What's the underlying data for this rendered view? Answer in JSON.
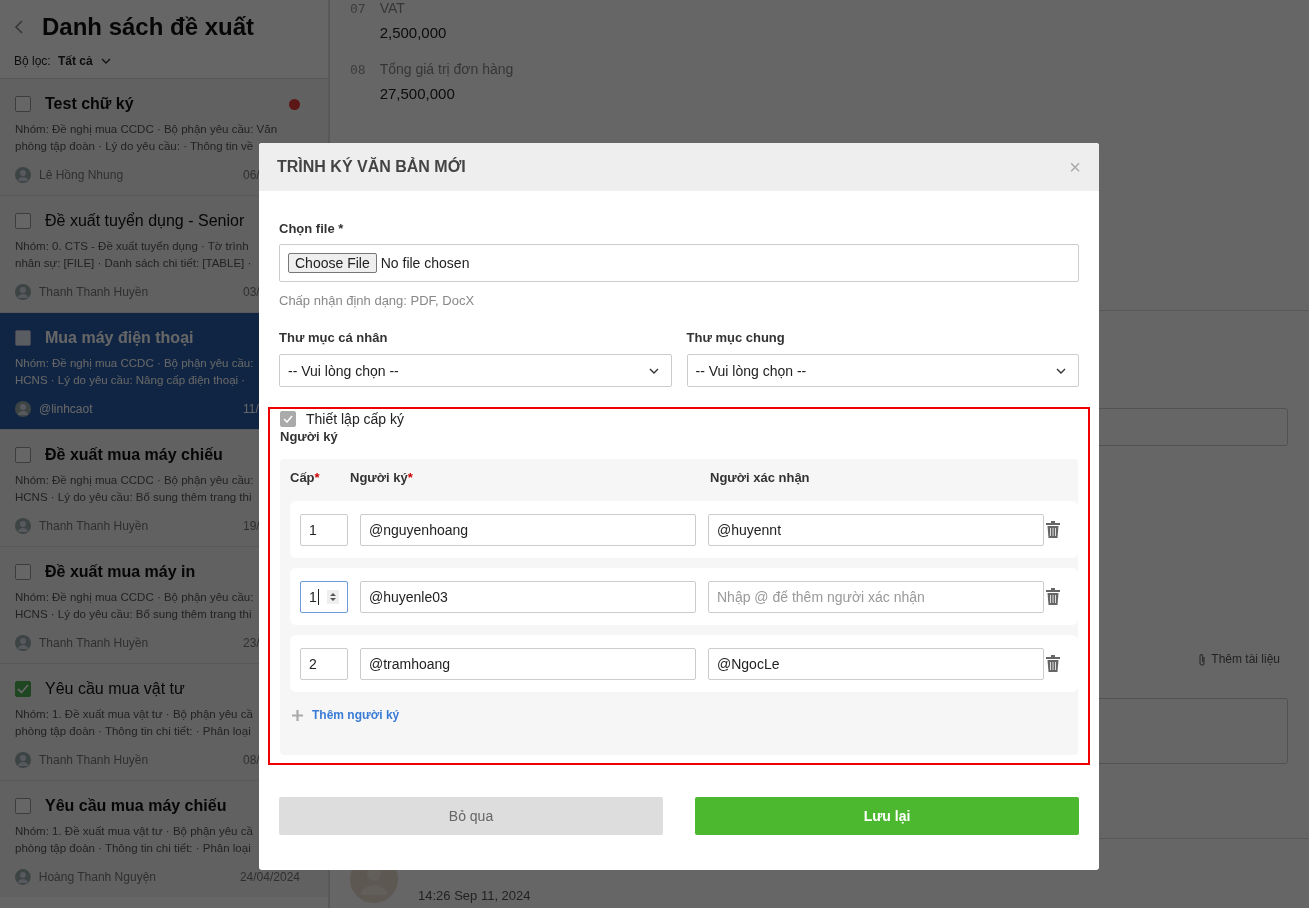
{
  "list_panel": {
    "title": "Danh sách đề xuất",
    "filter_label": "Bộ lọc:",
    "filter_value": "Tất cả",
    "items": [
      {
        "title": "Test chữ ký",
        "unread": true,
        "flagged": true,
        "checked": false,
        "selected": false,
        "description": [
          "Nhóm: Đề nghị mua CCDC · Bộ phận yêu cầu: Văn",
          "phòng tập đoàn · Lý do yêu cầu: · Thông tin về"
        ],
        "author": "Lê Hồng Nhung",
        "date": "06/"
      },
      {
        "title": "Đề xuất tuyển dụng - Senior",
        "unread": false,
        "flagged": false,
        "checked": false,
        "selected": false,
        "description": [
          "Nhóm: 0. CTS - Đề xuất tuyển dụng · Tờ trình",
          "nhân sự: [FILE] · Danh sách chi tiết: [TABLE] ·"
        ],
        "author": "Thanh Thanh Huyền",
        "date": "03/"
      },
      {
        "title": "Mua máy điện thoại",
        "unread": true,
        "flagged": false,
        "checked": false,
        "selected": true,
        "description": [
          "Nhóm: Đề nghị mua CCDC · Bộ phận yêu cầu:",
          "HCNS · Lý do yêu cầu: Nâng cấp điện thoại ·"
        ],
        "author": "@linhcaot",
        "date": "11/"
      },
      {
        "title": "Đề xuất mua máy chiếu",
        "unread": true,
        "flagged": false,
        "checked": false,
        "selected": false,
        "description": [
          "Nhóm: Đề nghị mua CCDC · Bộ phận yêu cầu:",
          "HCNS · Lý do yêu cầu: Bổ sung thêm trang thi"
        ],
        "author": "Thanh Thanh Huyền",
        "date": "19/"
      },
      {
        "title": "Đề xuất mua máy in",
        "unread": true,
        "flagged": false,
        "checked": false,
        "selected": false,
        "description": [
          "Nhóm: Đề nghị mua CCDC · Bộ phận yêu cầu:",
          "HCNS · Lý do yêu cầu: Bổ sung thêm trang thi"
        ],
        "author": "Thanh Thanh Huyền",
        "date": "23/"
      },
      {
        "title": "Yêu cầu mua vật tư",
        "unread": false,
        "flagged": false,
        "checked": true,
        "selected": false,
        "description": [
          "Nhóm: 1. Đề xuất mua vật tư · Bộ phận yêu cầ",
          "phòng tập đoàn · Thông tin chi tiết: · Phân loại"
        ],
        "author": "Thanh Thanh Huyền",
        "date": "08/"
      },
      {
        "title": "Yêu cầu mua máy chiếu",
        "unread": true,
        "flagged": false,
        "checked": false,
        "selected": false,
        "description": [
          "Nhóm: 1. Đề xuất mua vật tư · Bộ phận yêu cầ",
          "phòng tập đoàn · Thông tin chi tiết: · Phân loại"
        ],
        "author": "Hoàng Thanh Nguyện",
        "date": "24/04/2024"
      }
    ]
  },
  "detail": {
    "fields": [
      {
        "number": "07",
        "label": "VAT",
        "value": "2,500,000"
      },
      {
        "number": "08",
        "label": "Tổng giá trị đơn hàng",
        "value": "27,500,000"
      }
    ],
    "attach_link": "Thêm tài liệu",
    "activity_time": "14:26 Sep 11, 2024"
  },
  "dialog": {
    "title": "TRÌNH KÝ VĂN BẢN MỚI",
    "close": "×",
    "file_label": "Chọn file *",
    "file_button": "Choose File",
    "file_status": "No file chosen",
    "file_hint": "Chấp nhận định dạng: PDF, DocX",
    "folders": [
      {
        "label": "Thư mục cá nhân",
        "value": "-- Vui lòng chọn --"
      },
      {
        "label": "Thư mục chung",
        "value": "-- Vui lòng chọn --"
      }
    ],
    "signing": {
      "highlighted": true,
      "enabled": true,
      "toggle_label": "Thiết lập cấp ký",
      "section_label": "Người ký",
      "columns": [
        {
          "label": "Cấp",
          "mark": "*"
        },
        {
          "label": "Người ký",
          "mark": "*"
        },
        {
          "label": "Người xác nhận"
        }
      ],
      "rows": [
        {
          "level": "1",
          "focused": false,
          "signer": "@nguyenhoang",
          "confirmer": "@huyennt"
        },
        {
          "level": "1",
          "focused": true,
          "signer": "@huyenle03",
          "confirmer_placeholder": "Nhập @ để thêm người xác nhận"
        },
        {
          "level": "2",
          "focused": false,
          "signer": "@tramhoang",
          "confirmer": "@NgocLe"
        }
      ],
      "add_label": "Thêm người ký"
    },
    "buttons": [
      {
        "label": "Bỏ qua",
        "kind": "secondary"
      },
      {
        "label": "Lưu lại",
        "kind": "primary"
      }
    ]
  }
}
